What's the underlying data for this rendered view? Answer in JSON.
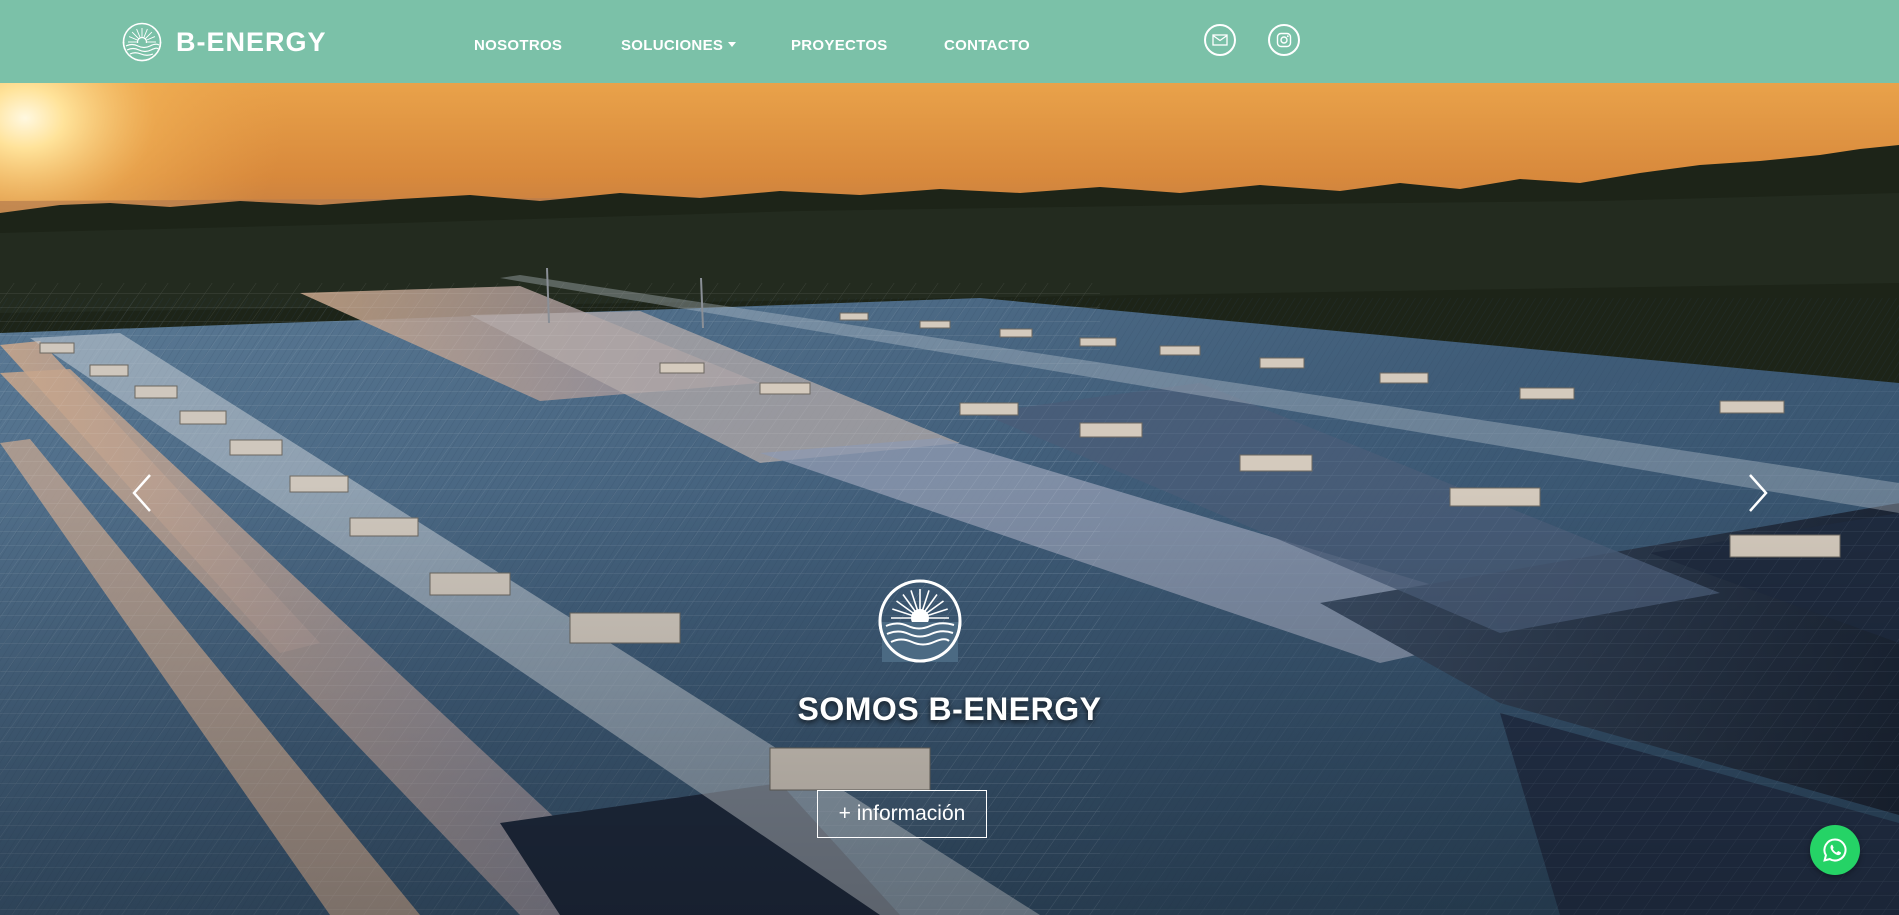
{
  "brand": {
    "name": "B-ENERGY",
    "logo_icon": "sun-waves-logo-icon"
  },
  "nav": {
    "items": [
      {
        "label": "NOSOTROS"
      },
      {
        "label": "SOLUCIONES",
        "dropdown": true
      },
      {
        "label": "PROYECTOS"
      },
      {
        "label": "CONTACTO"
      }
    ],
    "social": [
      {
        "icon": "email-icon"
      },
      {
        "icon": "instagram-icon"
      }
    ]
  },
  "hero": {
    "title": "SOMOS B-ENERGY",
    "button_label": "+ información",
    "prev_icon": "chevron-left-icon",
    "next_icon": "chevron-right-icon",
    "logo_icon": "sun-waves-logo-icon"
  },
  "whatsapp": {
    "icon": "whatsapp-icon",
    "color": "#25d366"
  },
  "colors": {
    "navbar": "#7bc1a8",
    "text": "#ffffff"
  }
}
